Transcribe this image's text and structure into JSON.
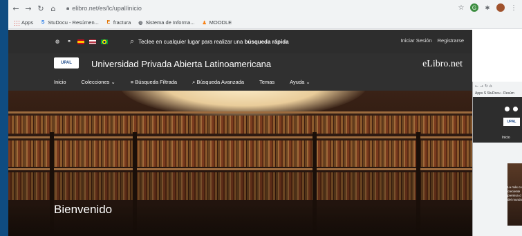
{
  "browser": {
    "url": "elibro.net/es/lc/upal/inicio",
    "bookmarks": [
      {
        "label": "Apps",
        "icon": "apps-grid-icon"
      },
      {
        "label": "StuDocu - Resúmen...",
        "icon": "studocu-icon"
      },
      {
        "label": "fractura",
        "icon": "bookmark-e-icon"
      },
      {
        "label": "Sistema de Informa...",
        "icon": "globe-icon"
      },
      {
        "label": "MOODLE",
        "icon": "moodle-icon"
      }
    ]
  },
  "site": {
    "search_prefix": "Teclee en cualquier lugar para realizar una ",
    "search_bold": "búsqueda rápida",
    "login": "Iniciar Sesión",
    "register": "Registrarse",
    "logo_text": "UPAL",
    "university_name": "Universidad Privada Abierta Latinoamericana",
    "brand": "eLibro.net",
    "menu": [
      "Inicio",
      "Colecciones ⌄",
      "≡ Búsqueda Filtrada",
      "⌕ Búsqueda Avanzada",
      "Temas",
      "Ayuda ⌄"
    ],
    "hero_title": "Bienvenido"
  },
  "side_window": {
    "bookmarks": "Apps  S StuDocu - Resúm",
    "logo_text": "UPAL",
    "menu_item": "Inicio",
    "text": "La más co creciente premisa d del mundo"
  },
  "colors": {
    "site_dark": "#2d2d2d",
    "header_dark": "#303030",
    "desktop_blue": "#0f4c81"
  }
}
